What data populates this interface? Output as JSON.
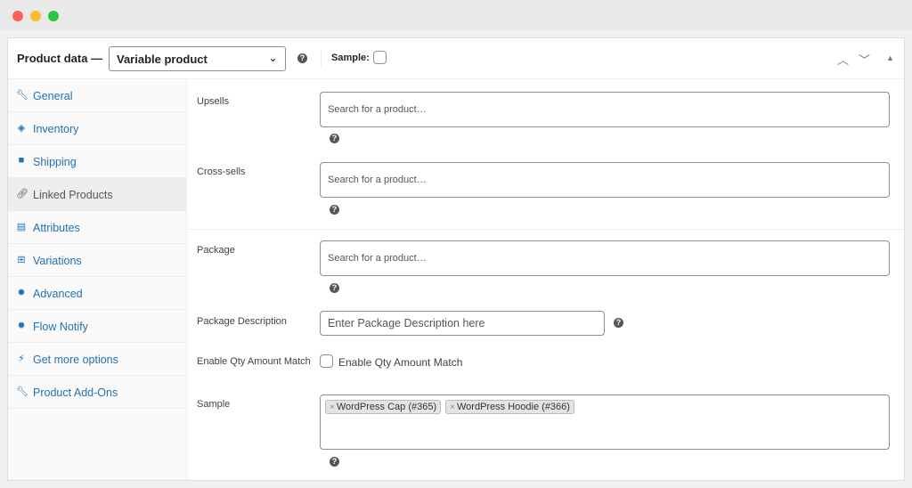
{
  "window": {
    "controls": [
      "close",
      "minimize",
      "maximize"
    ],
    "colors": {
      "close": "#fe5f57",
      "minimize": "#febc2e",
      "maximize": "#28c840"
    }
  },
  "header": {
    "title": "Product data —",
    "product_type": "Variable product",
    "sample_label": "Sample:",
    "sample_checked": false
  },
  "sidebar": {
    "items": [
      {
        "label": "General",
        "icon": "wrench-icon"
      },
      {
        "label": "Inventory",
        "icon": "tag-icon"
      },
      {
        "label": "Shipping",
        "icon": "truck-icon"
      },
      {
        "label": "Linked Products",
        "icon": "link-icon",
        "active": true
      },
      {
        "label": "Attributes",
        "icon": "list-icon"
      },
      {
        "label": "Variations",
        "icon": "grid-icon"
      },
      {
        "label": "Advanced",
        "icon": "gear-icon"
      },
      {
        "label": "Flow Notify",
        "icon": "gear-icon"
      },
      {
        "label": "Get more options",
        "icon": "plugin-icon"
      },
      {
        "label": "Product Add-Ons",
        "icon": "wrench-icon"
      }
    ]
  },
  "fields": {
    "upsells": {
      "label": "Upsells",
      "placeholder": "Search for a product…"
    },
    "cross_sells": {
      "label": "Cross-sells",
      "placeholder": "Search for a product…"
    },
    "package": {
      "label": "Package",
      "placeholder": "Search for a product…"
    },
    "package_description": {
      "label": "Package Description",
      "placeholder": "Enter Package Description here"
    },
    "qty_match": {
      "label": "Enable Qty Amount Match",
      "checkbox_label": "Enable Qty Amount Match",
      "checked": false
    },
    "sample": {
      "label": "Sample",
      "tags": [
        "WordPress Cap (#365)",
        "WordPress Hoodie (#366)"
      ]
    }
  },
  "colors": {
    "link": "#2271b1",
    "active_bg": "#eeeeee"
  }
}
